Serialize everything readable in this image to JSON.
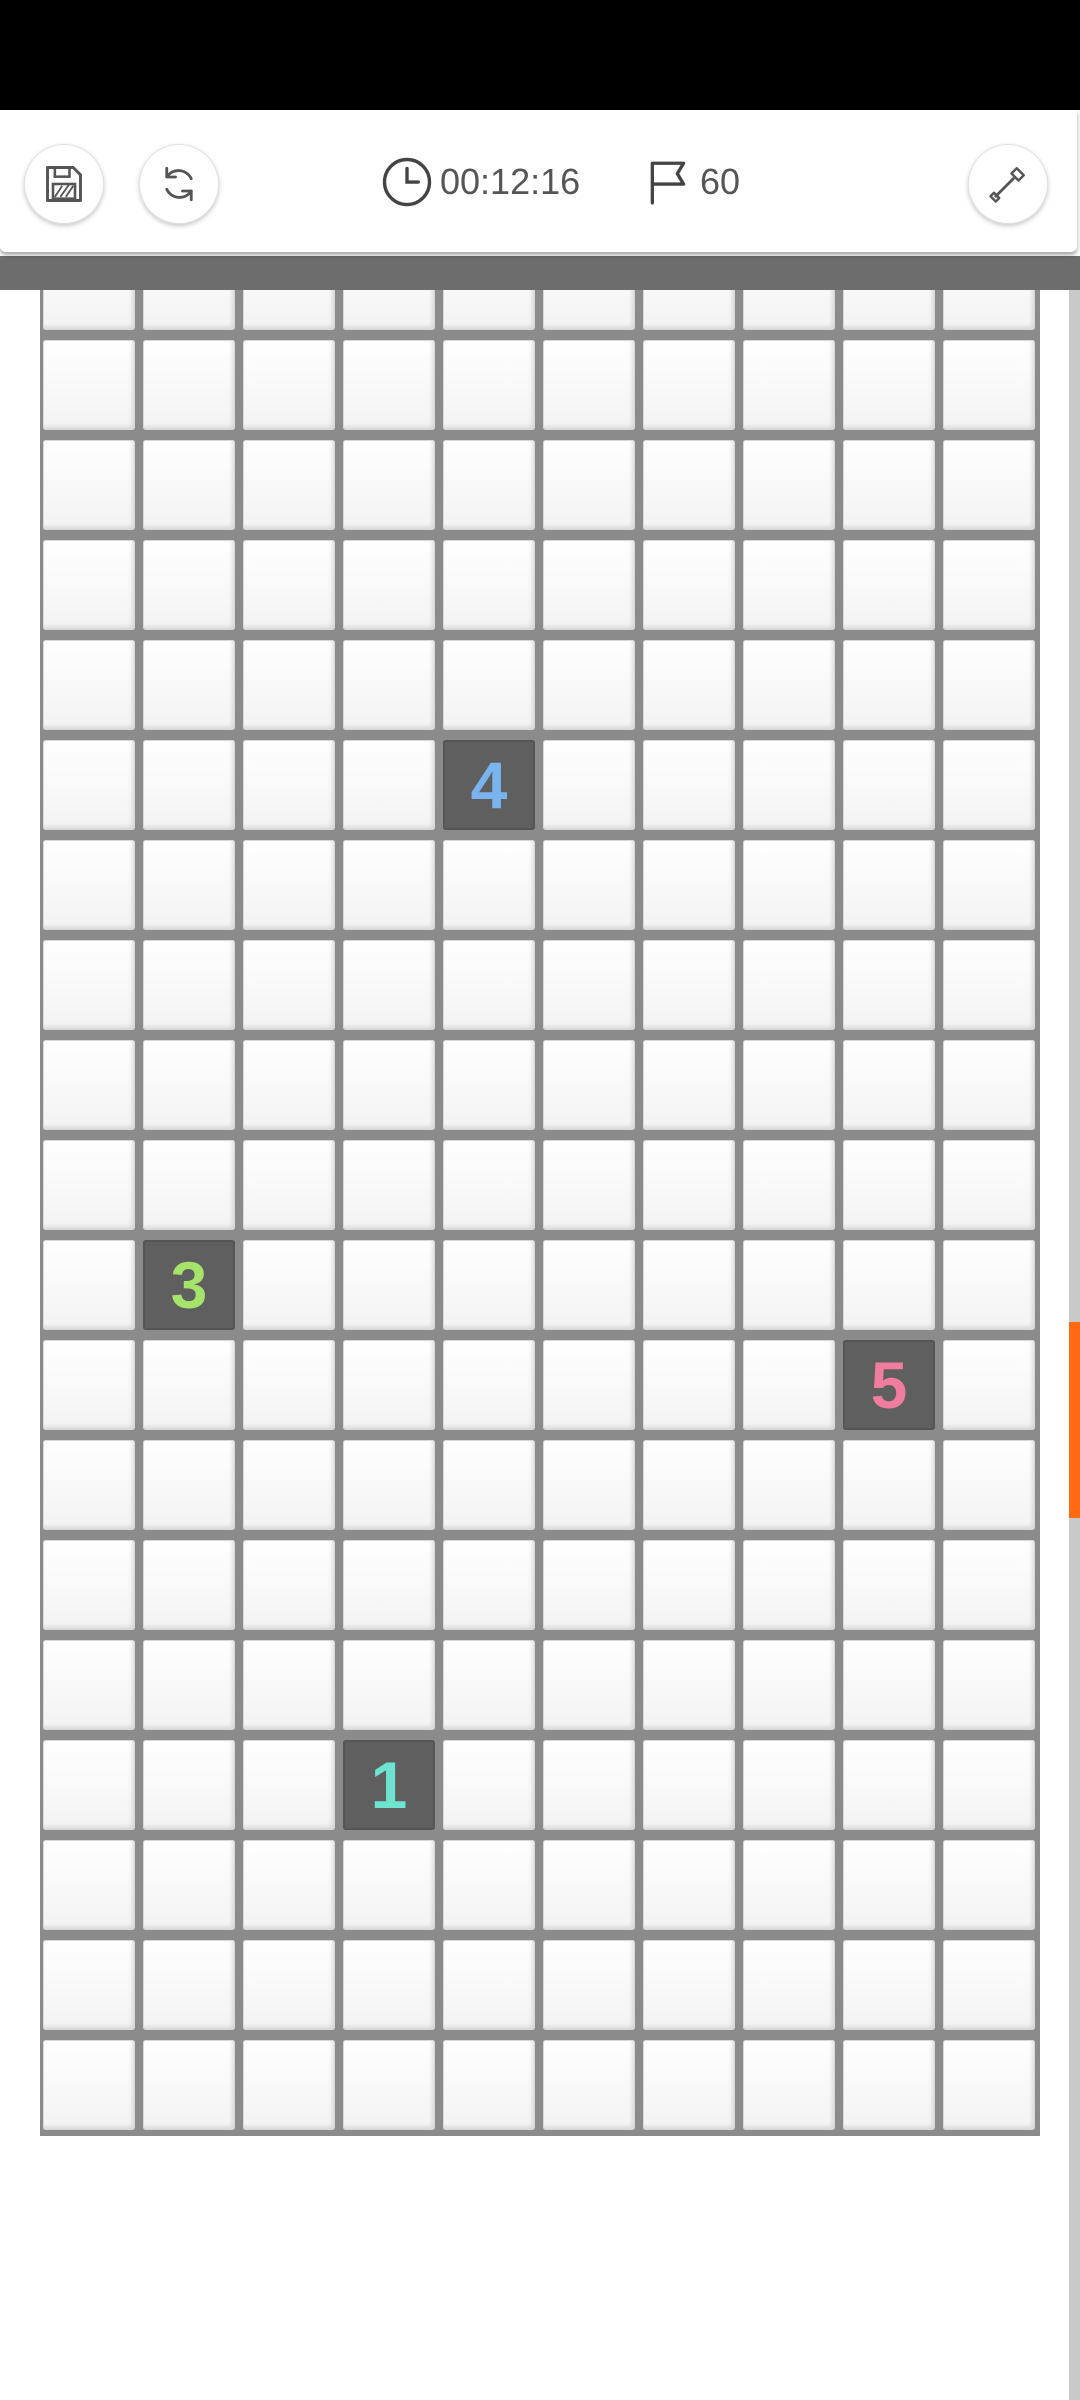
{
  "toolbar": {
    "save_icon": "floppy-disk-icon",
    "restart_icon": "refresh-icon",
    "timer_icon": "clock-icon",
    "timer": "00:12:16",
    "flag_icon": "flag-icon",
    "flags": "60",
    "tool_icon": "shovel-icon"
  },
  "board": {
    "columns": 10,
    "rows_visible": 19,
    "hidden_cell_color": "#f7f7f7",
    "revealed_cell_color": "#5f5f5f",
    "revealed": [
      {
        "row": 5,
        "col": 4,
        "value": "4",
        "color": "#7ab4ee"
      },
      {
        "row": 10,
        "col": 1,
        "value": "3",
        "color": "#a6e36a"
      },
      {
        "row": 11,
        "col": 8,
        "value": "5",
        "color": "#f07c9e"
      },
      {
        "row": 15,
        "col": 3,
        "value": "1",
        "color": "#6ee3cf"
      }
    ]
  },
  "scrollbar": {
    "thumb_color": "#ff6a13"
  }
}
